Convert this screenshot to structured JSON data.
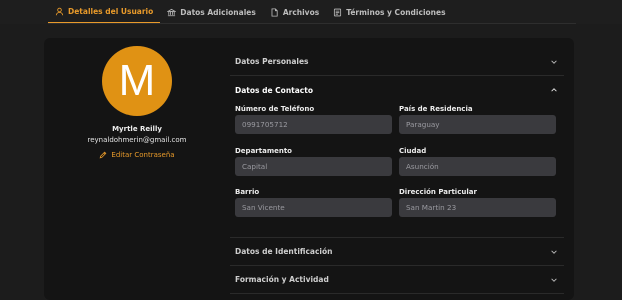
{
  "tabs": [
    {
      "label": "Detalles del Usuario",
      "icon": "user-icon",
      "active": true
    },
    {
      "label": "Datos Adicionales",
      "icon": "bank-icon",
      "active": false
    },
    {
      "label": "Archivos",
      "icon": "file-icon",
      "active": false
    },
    {
      "label": "Términos y Condiciones",
      "icon": "document-icon",
      "active": false
    }
  ],
  "profile": {
    "initial": "M",
    "avatar_color": "#e09214",
    "name": "Myrtle Reilly",
    "email": "reynaldohmerin@gmail.com",
    "edit_password_label": "Editar Contraseña"
  },
  "accent_color": "#e89a2a",
  "sections": {
    "personal": {
      "title": "Datos Personales",
      "expanded": false
    },
    "contact": {
      "title": "Datos de Contacto",
      "expanded": true,
      "fields": {
        "phone": {
          "label": "Número de Teléfono",
          "value": "0991705712"
        },
        "country": {
          "label": "País de Residencia",
          "value": "Paraguay"
        },
        "department": {
          "label": "Departamento",
          "value": "Capital"
        },
        "city": {
          "label": "Ciudad",
          "value": "Asunción"
        },
        "neighborhood": {
          "label": "Barrio",
          "value": "San Vicente"
        },
        "address": {
          "label": "Dirección Particular",
          "value": "San Martin 23"
        }
      }
    },
    "identification": {
      "title": "Datos de Identificación",
      "expanded": false
    },
    "training": {
      "title": "Formación y Actividad",
      "expanded": false
    }
  }
}
